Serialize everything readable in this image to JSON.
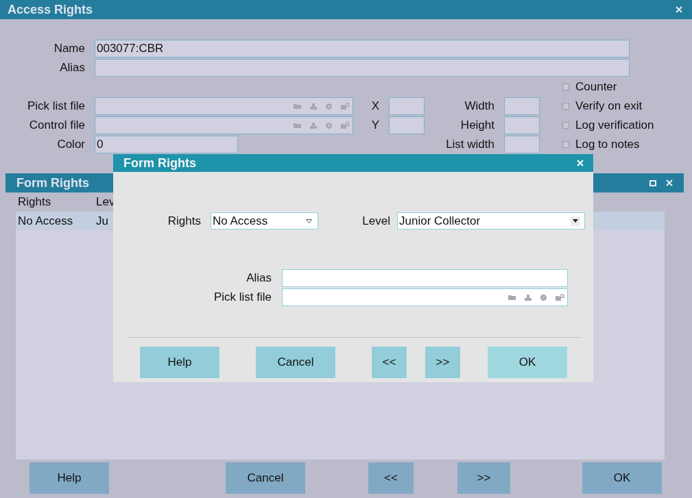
{
  "window": {
    "title": "Access Rights"
  },
  "fields": [
    {
      "label": "Name",
      "value": "003077:CBR"
    },
    {
      "label": "Alias"
    }
  ],
  "file_fields": [
    {
      "label": "Pick list file",
      "side_label": "X",
      "size_label": "Width"
    },
    {
      "label": "Control file",
      "side_label": "Y",
      "size_label": "Height"
    }
  ],
  "color_field": {
    "label": "Color",
    "value": "0",
    "size_label": "List width"
  },
  "checkboxes": [
    {
      "label": "Counter",
      "checked": false
    },
    {
      "label": "Verify on exit",
      "checked": false
    },
    {
      "label": "Log verification",
      "checked": false
    },
    {
      "label": "Log to notes",
      "checked": false
    }
  ],
  "form_rights_panel": {
    "title": "Form Rights",
    "columns": [
      "Rights",
      "Lev"
    ],
    "rows": [
      {
        "cells": [
          "No Access",
          "Ju"
        ],
        "selected": true
      }
    ]
  },
  "buttons": [
    "Help",
    "Cancel",
    "<<",
    ">>",
    "OK"
  ],
  "dialog": {
    "title": "Form Rights",
    "rights": {
      "label": "Rights",
      "value": "No Access"
    },
    "level": {
      "label": "Level",
      "value": "Junior Collector"
    },
    "alias": {
      "label": "Alias"
    },
    "pick_list_file": {
      "label": "Pick list file"
    },
    "buttons": [
      {
        "label": "Help",
        "default": false
      },
      {
        "label": "Cancel",
        "default": false
      },
      {
        "label": "<<",
        "default": false
      },
      {
        "label": ">>",
        "default": false
      },
      {
        "label": "OK",
        "default": true
      }
    ]
  }
}
